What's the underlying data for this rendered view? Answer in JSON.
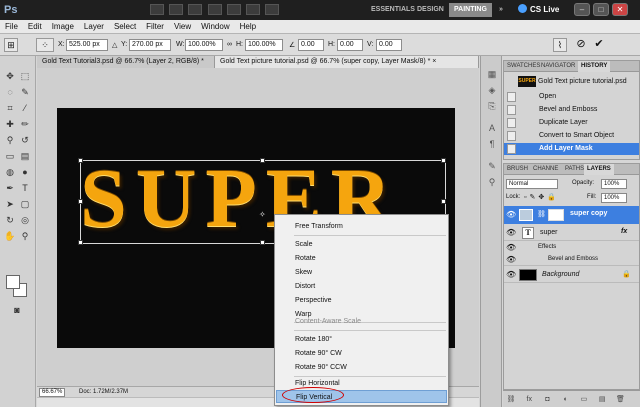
{
  "app": {
    "logo": "Ps",
    "workspaces": [
      "ESSENTIALS",
      "DESIGN",
      "PAINTING"
    ],
    "active_workspace": "PAINTING",
    "cs_live": "CS Live",
    "window_buttons": [
      "–",
      "□",
      "✕"
    ]
  },
  "menu": [
    "File",
    "Edit",
    "Image",
    "Layer",
    "Select",
    "Filter",
    "View",
    "Window",
    "Help"
  ],
  "options": {
    "x_label": "X:",
    "x_value": "525.00 px",
    "y_label": "Y:",
    "y_value": "270.00 px",
    "w_label": "W:",
    "w_value": "100.00%",
    "h_label": "H:",
    "h_value": "100.00%",
    "angle_value": "0.00",
    "h_skew_label": "H:",
    "h_skew_value": "0.00",
    "v_skew_label": "V:",
    "v_skew_value": "0.00"
  },
  "tabs": [
    {
      "label": "Gold Text Tutorial3.psd @ 66.7% (Layer 2, RGB/8) *",
      "close": "×"
    },
    {
      "label": "Gold Text picture tutorial.psd @ 66.7% (super copy, Layer Mask/8) *",
      "close": "×"
    }
  ],
  "canvas": {
    "text": "SUPER"
  },
  "context_menu": {
    "items": [
      {
        "label": "Free Transform",
        "disabled": false
      },
      {
        "label": "Scale",
        "disabled": false
      },
      {
        "label": "Rotate",
        "disabled": false
      },
      {
        "label": "Skew",
        "disabled": false
      },
      {
        "label": "Distort",
        "disabled": false
      },
      {
        "label": "Perspective",
        "disabled": false
      },
      {
        "label": "Warp",
        "disabled": false
      },
      {
        "label": "Content-Aware Scale",
        "disabled": true
      },
      {
        "label": "Rotate 180°",
        "disabled": false
      },
      {
        "label": "Rotate 90° CW",
        "disabled": false
      },
      {
        "label": "Rotate 90° CCW",
        "disabled": false
      },
      {
        "label": "Flip Horizontal",
        "disabled": false
      },
      {
        "label": "Flip Vertical",
        "disabled": false,
        "highlighted": true
      }
    ]
  },
  "status": {
    "zoom": "66.67%",
    "doc": "Doc: 1.72M/2.37M"
  },
  "history_panel": {
    "tabs": [
      "SWATCHES",
      "NAVIGATOR",
      "HISTORY"
    ],
    "active_tab": "HISTORY",
    "snapshot_label": "Gold Text picture tutorial.psd",
    "snapshot_thumb": "SUPER",
    "steps": [
      "Open",
      "Bevel and Emboss",
      "Duplicate Layer",
      "Convert to Smart Object",
      "Add Layer Mask"
    ],
    "selected_step": "Add Layer Mask"
  },
  "layers_panel": {
    "tabs": [
      "BRUSH",
      "CHANNE",
      "PATHS",
      "LAYERS"
    ],
    "active_tab": "LAYERS",
    "blend_mode": "Normal",
    "opacity_label": "Opacity:",
    "opacity_value": "100%",
    "lock_label": "Lock:",
    "fill_label": "Fill:",
    "fill_value": "100%",
    "layers": [
      {
        "name": "super copy",
        "selected": true
      },
      {
        "name": "super",
        "fx": "fx"
      },
      {
        "name": "Effects"
      },
      {
        "name": "Bevel and Emboss"
      },
      {
        "name": "Background"
      }
    ],
    "type_thumb": "T"
  },
  "colors": {
    "accent": "#3d7fe0",
    "gold": "#f5a50e",
    "highlight": "#9fc4ea"
  }
}
